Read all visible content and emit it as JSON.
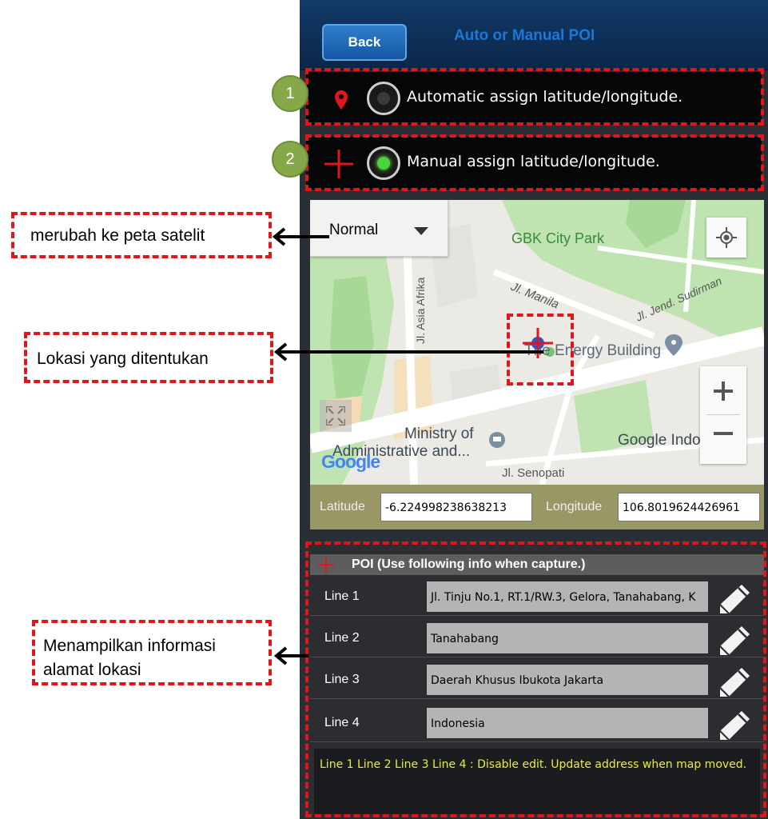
{
  "header": {
    "back_label": "Back",
    "title": "Auto or Manual POI"
  },
  "options": {
    "badge_1": "1",
    "automatic_label": "Automatic assign latitude/longitude.",
    "badge_2": "2",
    "manual_label": "Manual assign latitude/longitude.",
    "selected": "manual"
  },
  "map": {
    "type_selected": "Normal",
    "labels": {
      "park": "GBK City Park",
      "road_manila": "Jl. Manila",
      "road_sudirman": "Jl. Jend. Sudirman",
      "road_asia_afrika": "Jl. Asia Afrika",
      "energy_building": "The Energy Building",
      "ministry_1": "Ministry of",
      "ministry_2": "Administrative and...",
      "google_indonesia": "Google Indonesia",
      "senopati": "Jl. Senopati",
      "google_logo": "Google"
    },
    "latitude_label": "Latitude",
    "latitude_value": "-6.224998238638213",
    "longitude_label": "Longitude",
    "longitude_value": "106.8019624426961"
  },
  "poi": {
    "header": "POI (Use following info when capture.)",
    "rows": [
      {
        "label": "Line 1",
        "value": "Jl. Tinju No.1, RT.1/RW.3, Gelora, Tanahabang, K"
      },
      {
        "label": "Line 2",
        "value": "Tanahabang"
      },
      {
        "label": "Line 3",
        "value": "Daerah Khusus Ibukota Jakarta"
      },
      {
        "label": "Line 4",
        "value": "Indonesia"
      }
    ],
    "note": "Line 1 Line 2 Line 3 Line 4 : Disable edit. Update address when map moved."
  },
  "annotations": {
    "map_type": "merubah ke peta satelit",
    "location": "Lokasi yang ditentukan",
    "address_line1": "Menampilkan informasi",
    "address_line2": "alamat lokasi"
  },
  "colors": {
    "annotation_red": "#e0161b",
    "badge_green": "#86a84a",
    "topbar": "#123a69",
    "note_yellow": "#e9ee3a"
  },
  "icons": [
    "map-pin-icon",
    "crosshair-icon",
    "dropdown-arrow-icon",
    "my-location-icon",
    "zoom-in-icon",
    "zoom-out-icon",
    "fullscreen-icon",
    "pencil-icon"
  ]
}
